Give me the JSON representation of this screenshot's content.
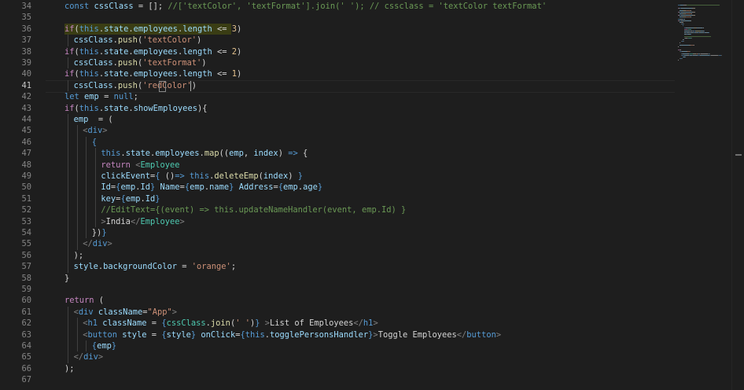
{
  "colors": {
    "keyword": "#c586c0",
    "storage": "#569cd6",
    "variable": "#9cdcfe",
    "function": "#dcdcaa",
    "string": "#ce9178",
    "comment": "#6a9955",
    "tag": "#569cd6",
    "component": "#4ec9b0",
    "attribute": "#9cdcfe",
    "punct": "#d4d4d4",
    "bracket": "#808080",
    "highlight": "#e2c08d"
  },
  "editor": {
    "active_line": 41,
    "lines": [
      {
        "n": 34,
        "indent": 0,
        "tokens": [
          [
            "storage",
            "const "
          ],
          [
            "variable",
            "cssClass"
          ],
          [
            "punct",
            " = []; "
          ],
          [
            "comment",
            "//['textColor', 'textFormat'].join(' '); // cssclass = 'textColor textFormat'"
          ]
        ]
      },
      {
        "n": 35,
        "indent": 0,
        "tokens": []
      },
      {
        "n": 36,
        "indent": 0,
        "tokens": [
          [
            "keyword",
            "if"
          ],
          [
            "punct",
            "("
          ],
          [
            "storage",
            "this"
          ],
          [
            "punct",
            "."
          ],
          [
            "variable",
            "state"
          ],
          [
            "punct",
            "."
          ],
          [
            "variable",
            "employees"
          ],
          [
            "punct",
            "."
          ],
          [
            "variable",
            "length"
          ],
          [
            "punct",
            " <= "
          ],
          [
            "highlight",
            "3"
          ],
          [
            "punct",
            ")"
          ]
        ]
      },
      {
        "n": 37,
        "indent": 1,
        "tokens": [
          [
            "variable",
            "cssClass"
          ],
          [
            "punct",
            "."
          ],
          [
            "function",
            "push"
          ],
          [
            "punct",
            "("
          ],
          [
            "string",
            "'textColor'"
          ],
          [
            "punct",
            ")"
          ]
        ]
      },
      {
        "n": 38,
        "indent": 0,
        "tokens": [
          [
            "keyword",
            "if"
          ],
          [
            "punct",
            "("
          ],
          [
            "storage",
            "this"
          ],
          [
            "punct",
            "."
          ],
          [
            "variable",
            "state"
          ],
          [
            "punct",
            "."
          ],
          [
            "variable",
            "employees"
          ],
          [
            "punct",
            "."
          ],
          [
            "variable",
            "length"
          ],
          [
            "punct",
            " <= "
          ],
          [
            "highlight",
            "2"
          ],
          [
            "punct",
            ")"
          ]
        ]
      },
      {
        "n": 39,
        "indent": 1,
        "tokens": [
          [
            "variable",
            "cssClass"
          ],
          [
            "punct",
            "."
          ],
          [
            "function",
            "push"
          ],
          [
            "punct",
            "("
          ],
          [
            "string",
            "'textFormat'"
          ],
          [
            "punct",
            ")"
          ]
        ]
      },
      {
        "n": 40,
        "indent": 0,
        "tokens": [
          [
            "keyword",
            "if"
          ],
          [
            "punct",
            "("
          ],
          [
            "storage",
            "this"
          ],
          [
            "punct",
            "."
          ],
          [
            "variable",
            "state"
          ],
          [
            "punct",
            "."
          ],
          [
            "variable",
            "employees"
          ],
          [
            "punct",
            "."
          ],
          [
            "variable",
            "length"
          ],
          [
            "punct",
            " <= "
          ],
          [
            "highlight",
            "1"
          ],
          [
            "punct",
            ")"
          ]
        ]
      },
      {
        "n": 41,
        "indent": 1,
        "tokens": [
          [
            "variable",
            "cssClass"
          ],
          [
            "punct",
            "."
          ],
          [
            "function",
            "push"
          ],
          [
            "punct",
            "("
          ],
          [
            "string",
            "'redColor'"
          ],
          [
            "punct",
            ")"
          ]
        ]
      },
      {
        "n": 42,
        "indent": 0,
        "tokens": [
          [
            "storage",
            "let "
          ],
          [
            "variable",
            "emp"
          ],
          [
            "punct",
            " = "
          ],
          [
            "storage",
            "null"
          ],
          [
            "punct",
            ";"
          ]
        ]
      },
      {
        "n": 43,
        "indent": 0,
        "tokens": [
          [
            "keyword",
            "if"
          ],
          [
            "punct",
            "("
          ],
          [
            "storage",
            "this"
          ],
          [
            "punct",
            "."
          ],
          [
            "variable",
            "state"
          ],
          [
            "punct",
            "."
          ],
          [
            "variable",
            "showEmployees"
          ],
          [
            "punct",
            "){"
          ]
        ]
      },
      {
        "n": 44,
        "indent": 1,
        "tokens": [
          [
            "variable",
            "emp"
          ],
          [
            "punct",
            "  = ("
          ]
        ]
      },
      {
        "n": 45,
        "indent": 2,
        "tokens": [
          [
            "bracket",
            "<"
          ],
          [
            "tag",
            "div"
          ],
          [
            "bracket",
            ">"
          ]
        ]
      },
      {
        "n": 46,
        "indent": 3,
        "tokens": [
          [
            "storage",
            "{"
          ]
        ]
      },
      {
        "n": 47,
        "indent": 4,
        "tokens": [
          [
            "storage",
            "this"
          ],
          [
            "punct",
            "."
          ],
          [
            "variable",
            "state"
          ],
          [
            "punct",
            "."
          ],
          [
            "variable",
            "employees"
          ],
          [
            "punct",
            "."
          ],
          [
            "function",
            "map"
          ],
          [
            "punct",
            "(("
          ],
          [
            "variable",
            "emp"
          ],
          [
            "punct",
            ", "
          ],
          [
            "variable",
            "index"
          ],
          [
            "punct",
            ") "
          ],
          [
            "storage",
            "=>"
          ],
          [
            "punct",
            " {"
          ]
        ]
      },
      {
        "n": 48,
        "indent": 4,
        "tokens": [
          [
            "keyword",
            "return "
          ],
          [
            "bracket",
            "<"
          ],
          [
            "component",
            "Employee"
          ]
        ]
      },
      {
        "n": 49,
        "indent": 4,
        "tokens": [
          [
            "attribute",
            "clickEvent"
          ],
          [
            "punct",
            "="
          ],
          [
            "storage",
            "{"
          ],
          [
            "punct",
            " ()"
          ],
          [
            "storage",
            "=>"
          ],
          [
            "punct",
            " "
          ],
          [
            "storage",
            "this"
          ],
          [
            "punct",
            "."
          ],
          [
            "function",
            "deleteEmp"
          ],
          [
            "punct",
            "("
          ],
          [
            "variable",
            "index"
          ],
          [
            "punct",
            ") "
          ],
          [
            "storage",
            "}"
          ]
        ]
      },
      {
        "n": 50,
        "indent": 4,
        "tokens": [
          [
            "attribute",
            "Id"
          ],
          [
            "punct",
            "="
          ],
          [
            "storage",
            "{"
          ],
          [
            "variable",
            "emp"
          ],
          [
            "punct",
            "."
          ],
          [
            "variable",
            "Id"
          ],
          [
            "storage",
            "}"
          ],
          [
            "punct",
            " "
          ],
          [
            "attribute",
            "Name"
          ],
          [
            "punct",
            "="
          ],
          [
            "storage",
            "{"
          ],
          [
            "variable",
            "emp"
          ],
          [
            "punct",
            "."
          ],
          [
            "variable",
            "name"
          ],
          [
            "storage",
            "}"
          ],
          [
            "punct",
            " "
          ],
          [
            "attribute",
            "Address"
          ],
          [
            "punct",
            "="
          ],
          [
            "storage",
            "{"
          ],
          [
            "variable",
            "emp"
          ],
          [
            "punct",
            "."
          ],
          [
            "variable",
            "age"
          ],
          [
            "storage",
            "}"
          ]
        ]
      },
      {
        "n": 51,
        "indent": 4,
        "tokens": [
          [
            "attribute",
            "key"
          ],
          [
            "punct",
            "="
          ],
          [
            "storage",
            "{"
          ],
          [
            "variable",
            "emp"
          ],
          [
            "punct",
            "."
          ],
          [
            "variable",
            "Id"
          ],
          [
            "storage",
            "}"
          ]
        ]
      },
      {
        "n": 52,
        "indent": 4,
        "tokens": [
          [
            "comment",
            "//EditText={(event) => this.updateNameHandler(event, emp.Id) }"
          ]
        ]
      },
      {
        "n": 53,
        "indent": 4,
        "tokens": [
          [
            "bracket",
            ">"
          ],
          [
            "punct",
            "India"
          ],
          [
            "bracket",
            "</"
          ],
          [
            "component",
            "Employee"
          ],
          [
            "bracket",
            ">"
          ]
        ]
      },
      {
        "n": 54,
        "indent": 3,
        "tokens": [
          [
            "punct",
            "})"
          ],
          [
            "storage",
            "}"
          ]
        ]
      },
      {
        "n": 55,
        "indent": 2,
        "tokens": [
          [
            "bracket",
            "</"
          ],
          [
            "tag",
            "div"
          ],
          [
            "bracket",
            ">"
          ]
        ]
      },
      {
        "n": 56,
        "indent": 1,
        "tokens": [
          [
            "punct",
            ");"
          ]
        ]
      },
      {
        "n": 57,
        "indent": 1,
        "tokens": [
          [
            "variable",
            "style"
          ],
          [
            "punct",
            "."
          ],
          [
            "variable",
            "backgroundColor"
          ],
          [
            "punct",
            " = "
          ],
          [
            "string",
            "'orange'"
          ],
          [
            "punct",
            ";"
          ]
        ]
      },
      {
        "n": 58,
        "indent": 0,
        "tokens": [
          [
            "punct",
            "}"
          ]
        ]
      },
      {
        "n": 59,
        "indent": 0,
        "tokens": []
      },
      {
        "n": 60,
        "indent": 0,
        "tokens": [
          [
            "keyword",
            "return"
          ],
          [
            "punct",
            " ("
          ]
        ]
      },
      {
        "n": 61,
        "indent": 1,
        "tokens": [
          [
            "bracket",
            "<"
          ],
          [
            "tag",
            "div"
          ],
          [
            "punct",
            " "
          ],
          [
            "attribute",
            "className"
          ],
          [
            "punct",
            "="
          ],
          [
            "string",
            "\"App\""
          ],
          [
            "bracket",
            ">"
          ]
        ]
      },
      {
        "n": 62,
        "indent": 2,
        "tokens": [
          [
            "bracket",
            "<"
          ],
          [
            "tag",
            "h1"
          ],
          [
            "punct",
            " "
          ],
          [
            "attribute",
            "className"
          ],
          [
            "punct",
            " = "
          ],
          [
            "storage",
            "{"
          ],
          [
            "component",
            "cssClass"
          ],
          [
            "punct",
            "."
          ],
          [
            "function",
            "join"
          ],
          [
            "punct",
            "("
          ],
          [
            "string",
            "' '"
          ],
          [
            "punct",
            ")"
          ],
          [
            "storage",
            "}"
          ],
          [
            "punct",
            " "
          ],
          [
            "bracket",
            ">"
          ],
          [
            "punct",
            "List of Employees"
          ],
          [
            "bracket",
            "</"
          ],
          [
            "tag",
            "h1"
          ],
          [
            "bracket",
            ">"
          ]
        ]
      },
      {
        "n": 63,
        "indent": 2,
        "tokens": [
          [
            "bracket",
            "<"
          ],
          [
            "tag",
            "button"
          ],
          [
            "punct",
            " "
          ],
          [
            "attribute",
            "style"
          ],
          [
            "punct",
            " = "
          ],
          [
            "storage",
            "{"
          ],
          [
            "variable",
            "style"
          ],
          [
            "storage",
            "}"
          ],
          [
            "punct",
            " "
          ],
          [
            "attribute",
            "onClick"
          ],
          [
            "punct",
            "="
          ],
          [
            "storage",
            "{"
          ],
          [
            "storage",
            "this"
          ],
          [
            "punct",
            "."
          ],
          [
            "variable",
            "togglePersonsHandler"
          ],
          [
            "storage",
            "}"
          ],
          [
            "bracket",
            ">"
          ],
          [
            "punct",
            "Toggle Employees"
          ],
          [
            "bracket",
            "</"
          ],
          [
            "tag",
            "button"
          ],
          [
            "bracket",
            ">"
          ]
        ]
      },
      {
        "n": 64,
        "indent": 3,
        "tokens": [
          [
            "storage",
            "{"
          ],
          [
            "variable",
            "emp"
          ],
          [
            "storage",
            "}"
          ]
        ]
      },
      {
        "n": 65,
        "indent": 1,
        "tokens": [
          [
            "bracket",
            "</"
          ],
          [
            "tag",
            "div"
          ],
          [
            "bracket",
            ">"
          ]
        ]
      },
      {
        "n": 66,
        "indent": 0,
        "tokens": [
          [
            "punct",
            ");"
          ]
        ]
      },
      {
        "n": 67,
        "indent": 0,
        "tokens": []
      }
    ]
  }
}
